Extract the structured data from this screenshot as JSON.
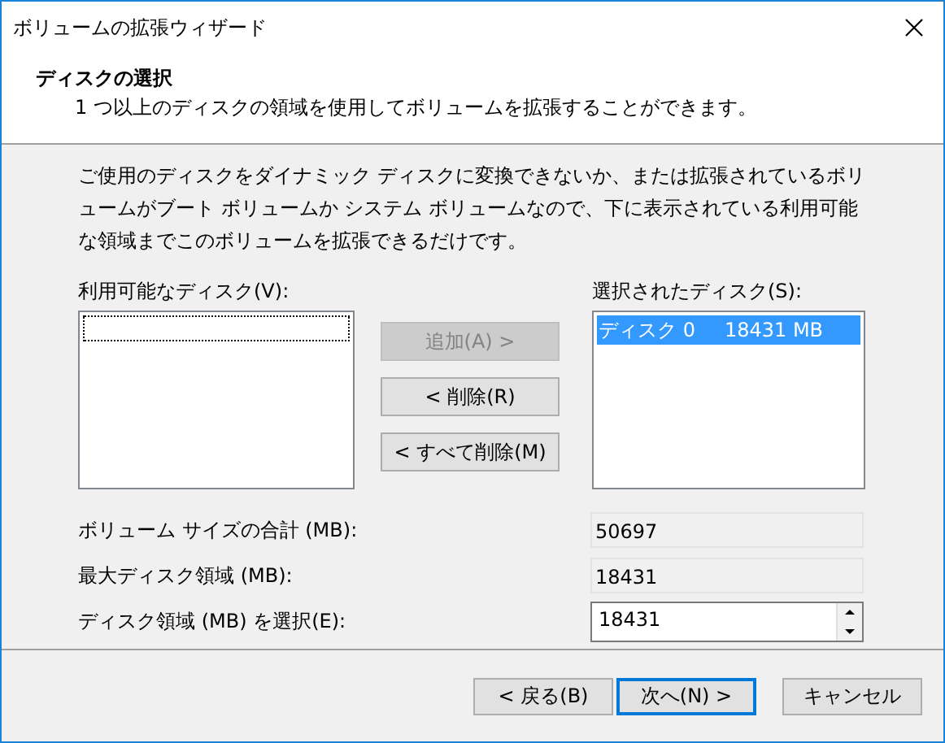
{
  "window": {
    "title": "ボリュームの拡張ウィザード"
  },
  "header": {
    "title": "ディスクの選択",
    "subtitle": "1 つ以上のディスクの領域を使用してボリュームを拡張することができます。"
  },
  "description": "ご使用のディスクをダイナミック ディスクに変換できないか、または拡張されているボリュームがブート ボリュームか システム ボリュームなので、下に表示されている利用可能な領域までこのボリュームを拡張できるだけです。",
  "available_disks": {
    "label": "利用可能なディスク(V):"
  },
  "move_buttons": [
    {
      "label": "追加(A) >",
      "disabled": true
    },
    {
      "label": "< 削除(R)",
      "disabled": false
    },
    {
      "label": "< すべて削除(M)",
      "disabled": false
    }
  ],
  "selected_disks": {
    "label": "選択されたディスク(S):",
    "items": [
      {
        "name": "ディスク 0",
        "size": "18431 MB",
        "selected": true
      }
    ]
  },
  "fields": [
    {
      "label": "ボリューム サイズの合計 (MB):",
      "value": "50697",
      "kind": "readonly"
    },
    {
      "label": "最大ディスク領域 (MB):",
      "value": "18431",
      "kind": "readonly"
    },
    {
      "label": "ディスク領域 (MB) を選択(E):",
      "value": "18431",
      "kind": "spinner"
    }
  ],
  "buttons": [
    {
      "label": "< 戻る(B)",
      "default": false
    },
    {
      "label": "次へ(N) >",
      "default": true
    },
    {
      "label": "キャンセル",
      "default": false
    }
  ]
}
